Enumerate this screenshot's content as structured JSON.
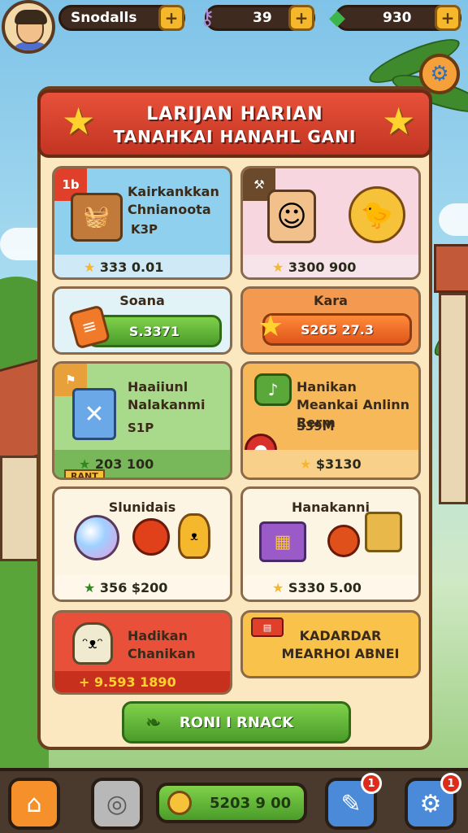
{
  "top_bar": {
    "player_name": "Snodalls",
    "resources": [
      {
        "icon": "key-icon",
        "value": "39"
      },
      {
        "icon": "gem-icon",
        "value": "930"
      }
    ]
  },
  "panel": {
    "title_line1": "LARIJAN HARIAN",
    "title_line2": "TANAHKAI HANAHL GANI"
  },
  "cards": [
    {
      "ribbon": "1b",
      "title": "Kairkankkan Chnianoota",
      "sub": "K3P",
      "foot": "333 0.01"
    },
    {
      "title": "",
      "foot": "3300 900"
    },
    {
      "label": "Soana",
      "button": "S.3371"
    },
    {
      "label": "Kara",
      "button": "S265 27.3"
    },
    {
      "title": "Haaiiunl Nalakanmi",
      "sub": "S1P",
      "foot": "203 100",
      "tag": "RANT"
    },
    {
      "title": "Hanikan Meankai Anlinn Rerm",
      "sub": "S39M",
      "foot": "$3130"
    },
    {
      "title": "Slunidais",
      "foot": "356 $200"
    },
    {
      "title": "Hanakanni",
      "foot": "S330 5.00"
    },
    {
      "title": "Hadikan Chanikan",
      "foot": "9.593 1890"
    },
    {
      "title": "KADARDAR MEARHOI ABNEI"
    }
  ],
  "action_button": "RONI I RNACK",
  "bottom_nav": {
    "center_value": "5203 9 00",
    "badges": [
      "1",
      "1"
    ]
  },
  "colors": {
    "header_red": "#d8402a",
    "panel_bg": "#fbe7c0",
    "green_btn": "#5cb83a",
    "orange_btn": "#f06a24"
  }
}
